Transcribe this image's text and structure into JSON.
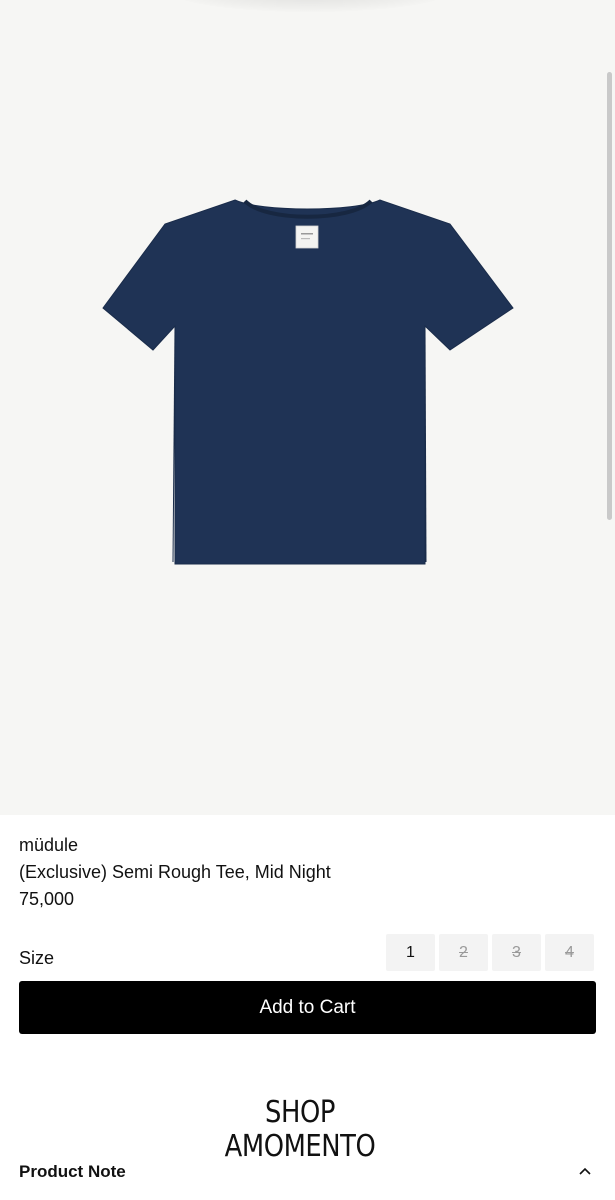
{
  "product": {
    "brand": "müdule",
    "name": "(Exclusive) Semi Rough Tee, Mid Night",
    "price": "75,000",
    "image_icon": "navy-tshirt-image",
    "color": "#1f3355"
  },
  "size_selector": {
    "label": "Size",
    "options": [
      {
        "label": "1",
        "available": true
      },
      {
        "label": "2",
        "available": false
      },
      {
        "label": "3",
        "available": false
      },
      {
        "label": "4",
        "available": false
      }
    ]
  },
  "cart": {
    "button_label": "Add to Cart"
  },
  "shop_logo": {
    "line1": "SHOP",
    "line2": "AMOMENTO"
  },
  "product_note": {
    "label": "Product Note",
    "icon": "chevron-up-icon"
  },
  "colors": {
    "background": "#f6f6f4",
    "button": "#000000",
    "size_chip": "#f3f3f3"
  }
}
